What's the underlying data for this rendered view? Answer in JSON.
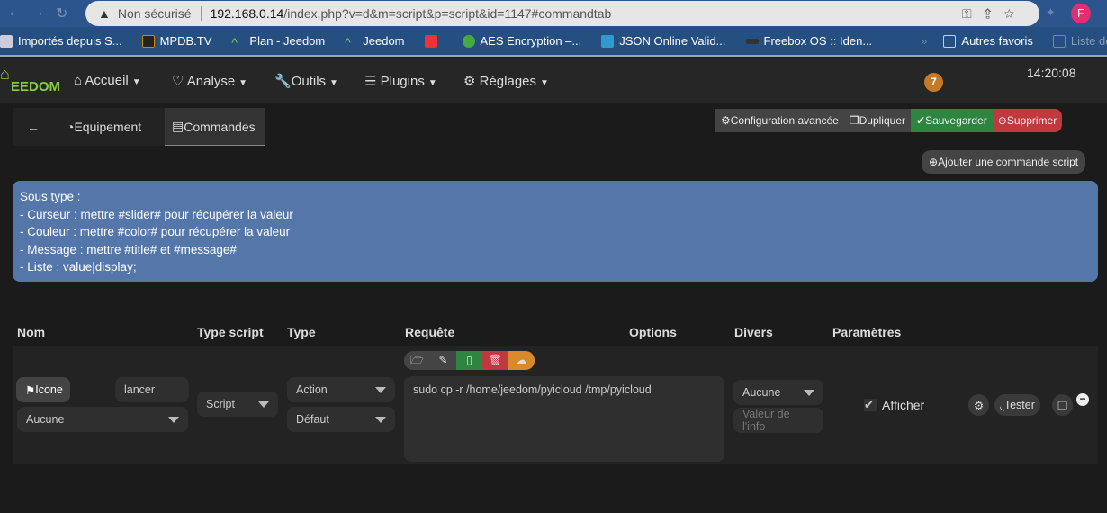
{
  "browser": {
    "security": "Non sécurisé",
    "host": "192.168.0.14",
    "path": "/index.php?v=d&m=script&p=script&id=1147#commandtab",
    "profile": "F",
    "bookmarks": [
      {
        "label": "Importés depuis S...",
        "color": "#ccd"
      },
      {
        "label": "MPDB.TV",
        "color": "#222"
      },
      {
        "label": "Plan - Jeedom",
        "color": "#8c4"
      },
      {
        "label": "Jeedom",
        "color": "#8c4"
      },
      {
        "label": "",
        "color": "#e33"
      },
      {
        "label": "AES Encryption –...",
        "color": "#4a4"
      },
      {
        "label": "JSON Online Valid...",
        "color": "#39c"
      },
      {
        "label": "Freebox OS :: Iden...",
        "color": "#333"
      }
    ],
    "more": "»",
    "other": "Autres favoris",
    "reading": "Liste de lecture"
  },
  "app": {
    "logo": "EEDOM",
    "menu": [
      "Accueil",
      "Analyse",
      "Outils",
      "Plugins",
      "Réglages"
    ],
    "badge": "7",
    "clock": "14:20:08"
  },
  "tabs": {
    "back": "←",
    "equipement": "Equipement",
    "commandes": "Commandes"
  },
  "actions": {
    "config": "Configuration avancée",
    "dup": "Dupliquer",
    "save": "Sauvegarder",
    "delete": "Supprimer",
    "add": "Ajouter une commande script"
  },
  "colors": {
    "save": "#2e8540",
    "delete": "#c0393f",
    "upload": "#d88a2a",
    "info": "#5476a9"
  },
  "info": [
    "Sous type :",
    "- Curseur : mettre #slider# pour récupérer la valeur",
    "- Couleur : mettre #color# pour récupérer la valeur",
    "- Message : mettre #title# et #message#",
    "- Liste : value|display;"
  ],
  "table": {
    "headers": [
      "Nom",
      "Type script",
      "Type",
      "Requête",
      "Options",
      "Divers",
      "Paramètres"
    ],
    "row": {
      "icon_btn": "Icone",
      "name": "lancer",
      "icon_select": "Aucune",
      "type_script": "Script",
      "type": "Action",
      "subtype": "Défaut",
      "request": "sudo cp -r /home/jeedom/pyicloud /tmp/pyicloud",
      "divers": "Aucune",
      "info_placeholder": "Valeur de l'info",
      "show": "Afficher",
      "test": "Tester"
    }
  }
}
